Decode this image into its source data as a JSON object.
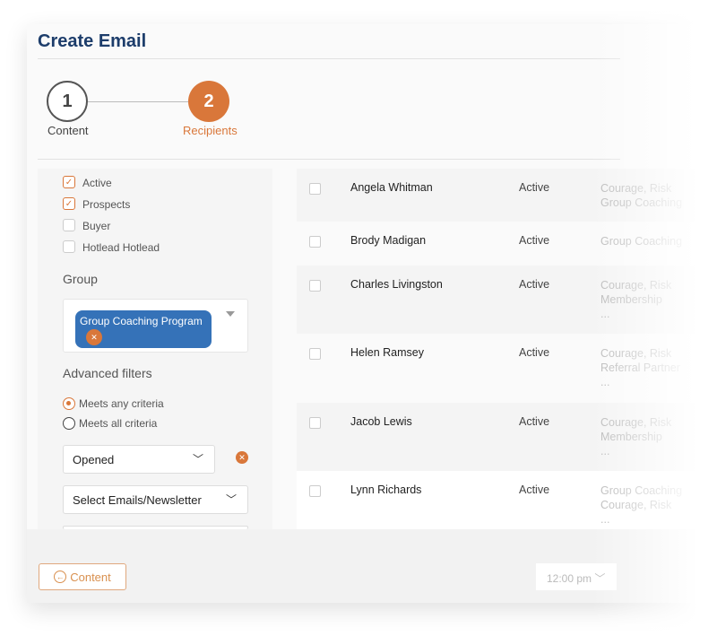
{
  "title": "Create Email",
  "steps": [
    {
      "number": "1",
      "label": "Content"
    },
    {
      "number": "2",
      "label": "Recipients"
    }
  ],
  "status_filters": [
    {
      "label": "Active",
      "checked": true
    },
    {
      "label": "Prospects",
      "checked": true
    },
    {
      "label": "Buyer",
      "checked": false
    },
    {
      "label": "Hotlead Hotlead",
      "checked": false
    }
  ],
  "group": {
    "heading": "Group",
    "chip": "Group Coaching Program"
  },
  "advanced": {
    "heading": "Advanced filters",
    "options": [
      "Meets any criteria",
      "Meets all criteria"
    ],
    "selected": 0,
    "filter_select": "Opened",
    "email_select": "Select Emails/Newsletter"
  },
  "rows": [
    {
      "name": "Angela Whitman",
      "status": "Active",
      "tags": "Courage, Risk\nGroup Coaching"
    },
    {
      "name": "Brody Madigan",
      "status": "Active",
      "tags": "Group Coaching"
    },
    {
      "name": "Charles Livingston",
      "status": "Active",
      "tags": "Courage, Risk\nMembership\n..."
    },
    {
      "name": "Helen Ramsey",
      "status": "Active",
      "tags": "Courage, Risk\nReferral Partner\n..."
    },
    {
      "name": "Jacob Lewis",
      "status": "Active",
      "tags": "Courage, Risk\nMembership\n..."
    },
    {
      "name": "Lynn Richards",
      "status": "Active",
      "tags": "Group Coaching\nCourage, Risk\n..."
    }
  ],
  "footer": {
    "back_label": "Content",
    "time": "12:00 pm"
  },
  "colors": {
    "accent": "#d9773a",
    "chip": "#3572b8",
    "title": "#1d3d6b"
  }
}
